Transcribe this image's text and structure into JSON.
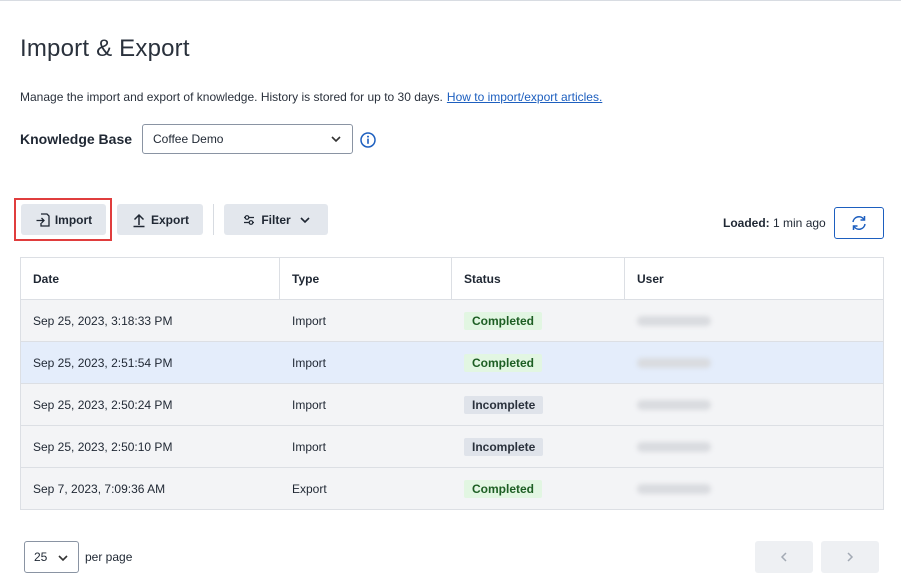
{
  "page": {
    "title": "Import & Export",
    "description": "Manage the import and export of knowledge. History is stored for up to 30 days.",
    "help_link": "How to import/export articles."
  },
  "knowledge_base": {
    "label": "Knowledge Base",
    "selected": "Coffee Demo"
  },
  "toolbar": {
    "import_label": "Import",
    "export_label": "Export",
    "filter_label": "Filter",
    "loaded_label": "Loaded:",
    "loaded_value": "1 min ago"
  },
  "table": {
    "headers": [
      "Date",
      "Type",
      "Status",
      "User"
    ],
    "rows": [
      {
        "date": "Sep 25, 2023, 3:18:33 PM",
        "type": "Import",
        "status": "Completed"
      },
      {
        "date": "Sep 25, 2023, 2:51:54 PM",
        "type": "Import",
        "status": "Completed"
      },
      {
        "date": "Sep 25, 2023, 2:50:24 PM",
        "type": "Import",
        "status": "Incomplete"
      },
      {
        "date": "Sep 25, 2023, 2:50:10 PM",
        "type": "Import",
        "status": "Incomplete"
      },
      {
        "date": "Sep 7, 2023, 7:09:36 AM",
        "type": "Export",
        "status": "Completed"
      }
    ]
  },
  "pagination": {
    "per_page_value": "25",
    "per_page_label": "per page"
  },
  "icons": {
    "import": "import-icon",
    "export": "upload-icon",
    "filter": "sliders-icon",
    "refresh": "refresh-icon",
    "info": "info-icon"
  },
  "colors": {
    "accent": "#1d5fbf",
    "highlight_border": "#e03d3d",
    "completed_bg": "#e2f6e2",
    "incomplete_bg": "#dfe3ea",
    "selected_row": "#e4edfb"
  }
}
